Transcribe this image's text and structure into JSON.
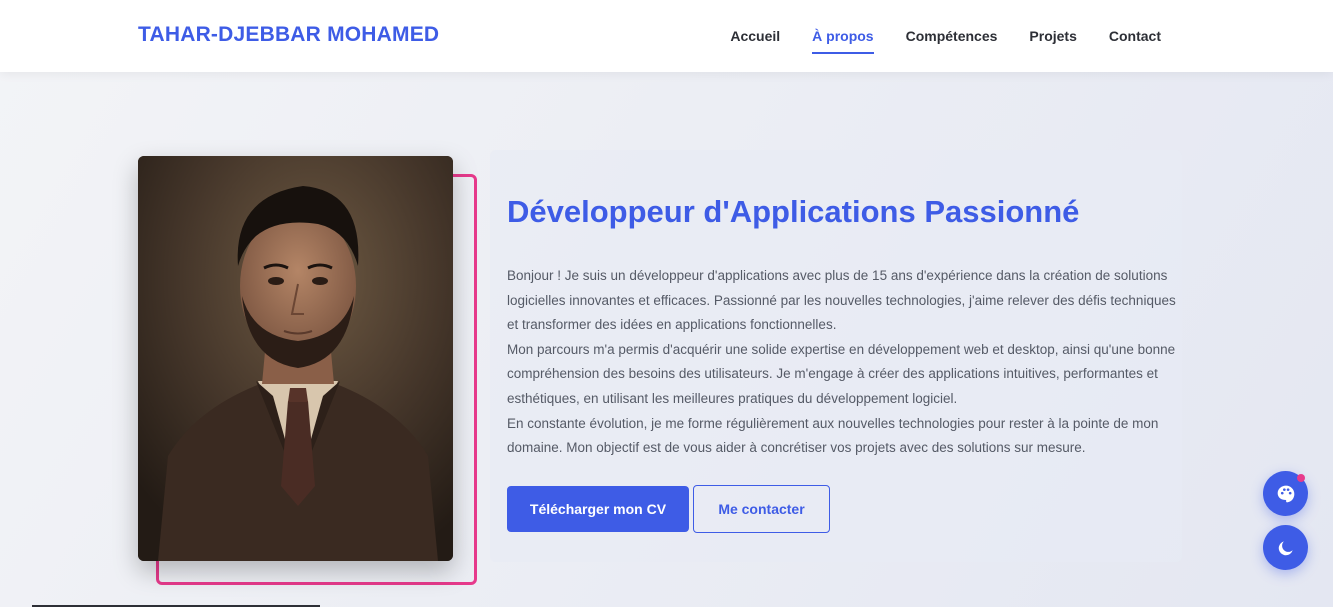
{
  "header": {
    "brand": "TAHAR-DJEBBAR MOHAMED",
    "nav": [
      {
        "label": "Accueil",
        "active": false
      },
      {
        "label": "À propos",
        "active": true
      },
      {
        "label": "Compétences",
        "active": false
      },
      {
        "label": "Projets",
        "active": false
      },
      {
        "label": "Contact",
        "active": false
      }
    ]
  },
  "about": {
    "title": "Développeur d'Applications Passionné",
    "paragraphs": [
      "Bonjour ! Je suis un développeur d'applications avec plus de 15 ans d'expérience dans la création de solutions logicielles innovantes et efficaces. Passionné par les nouvelles technologies, j'aime relever des défis techniques et transformer des idées en applications fonctionnelles.",
      "Mon parcours m'a permis d'acquérir une solide expertise en développement web et desktop, ainsi qu'une bonne compréhension des besoins des utilisateurs. Je m'engage à créer des applications intuitives, performantes et esthétiques, en utilisant les meilleures pratiques du développement logiciel.",
      "En constante évolution, je me forme régulièrement aux nouvelles technologies pour rester à la pointe de mon domaine. Mon objectif est de vous aider à concrétiser vos projets avec des solutions sur mesure."
    ],
    "btn_cv": "Télécharger mon CV",
    "btn_contact": "Me contacter"
  },
  "floating": {
    "theme_icon": "palette-icon",
    "mode_icon": "moon-icon"
  },
  "colors": {
    "accent": "#3e5ce6",
    "frame": "#e73a8c"
  }
}
